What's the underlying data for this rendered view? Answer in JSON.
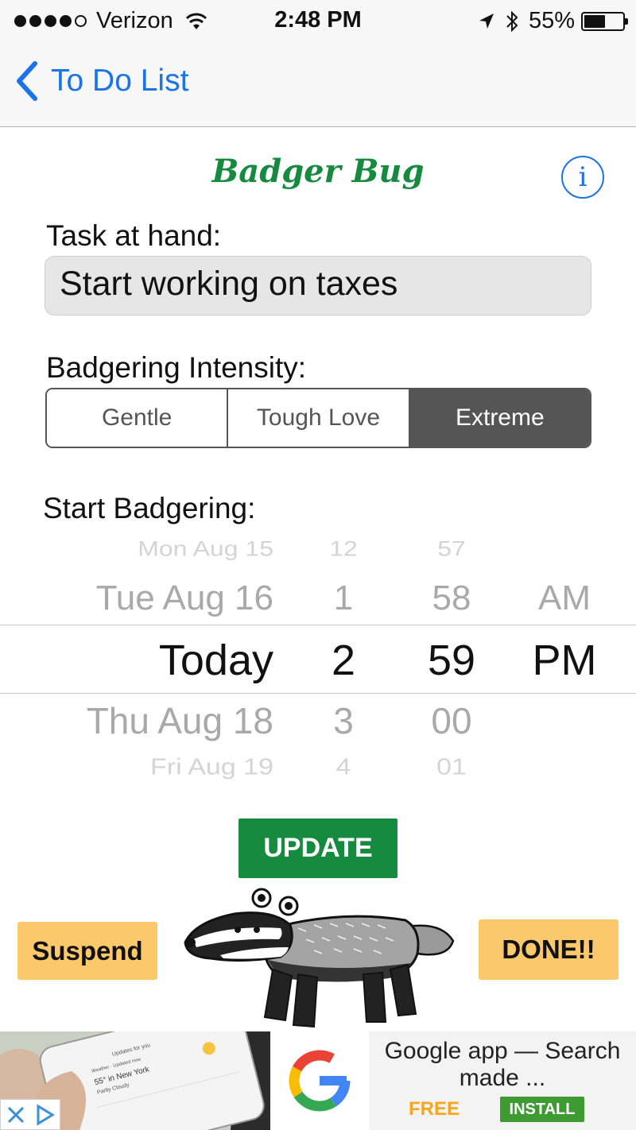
{
  "status_bar": {
    "carrier": "Verizon",
    "time": "2:48 PM",
    "battery": "55%",
    "battery_level": 0.55,
    "icons": [
      "signal-dots-icon",
      "wifi-icon",
      "location-arrow-icon",
      "bluetooth-icon",
      "battery-icon"
    ]
  },
  "nav": {
    "back_label": "To Do List"
  },
  "header": {
    "title": "Badger Bug",
    "info_glyph": "i"
  },
  "task": {
    "label": "Task at hand:",
    "value": "Start working on taxes"
  },
  "intensity": {
    "label": "Badgering Intensity:",
    "options": [
      "Gentle",
      "Tough Love",
      "Extreme"
    ],
    "selected": "Extreme"
  },
  "start": {
    "label": "Start Badgering:",
    "picker": {
      "dates": [
        "Mon Aug 15",
        "Tue Aug 16",
        "Today",
        "Thu Aug 18",
        "Fri Aug 19"
      ],
      "hours": [
        "12",
        "1",
        "2",
        "3",
        "4"
      ],
      "minutes": [
        "57",
        "58",
        "59",
        "00",
        "01"
      ],
      "ampm": [
        "AM",
        "PM"
      ],
      "selected": {
        "date": "Today",
        "hour": "2",
        "minute": "59",
        "ampm": "PM"
      }
    }
  },
  "buttons": {
    "update": "UPDATE",
    "suspend": "Suspend",
    "done": "DONE!!"
  },
  "ad": {
    "title": "Google app — Search made ...",
    "free": "FREE",
    "install": "INSTALL",
    "phone_text": [
      "Updates for you",
      "55° in New York",
      "Partly Cloudy",
      "Weather · Updated now"
    ]
  },
  "colors": {
    "accent_blue": "#1a73e8",
    "title_green": "#168a3e",
    "update_green": "#168a3e",
    "action_yellow": "#fbc96b",
    "segment_selected": "#555555",
    "ad_install_green": "#3e9b32",
    "ad_free_orange": "#f5a623"
  }
}
